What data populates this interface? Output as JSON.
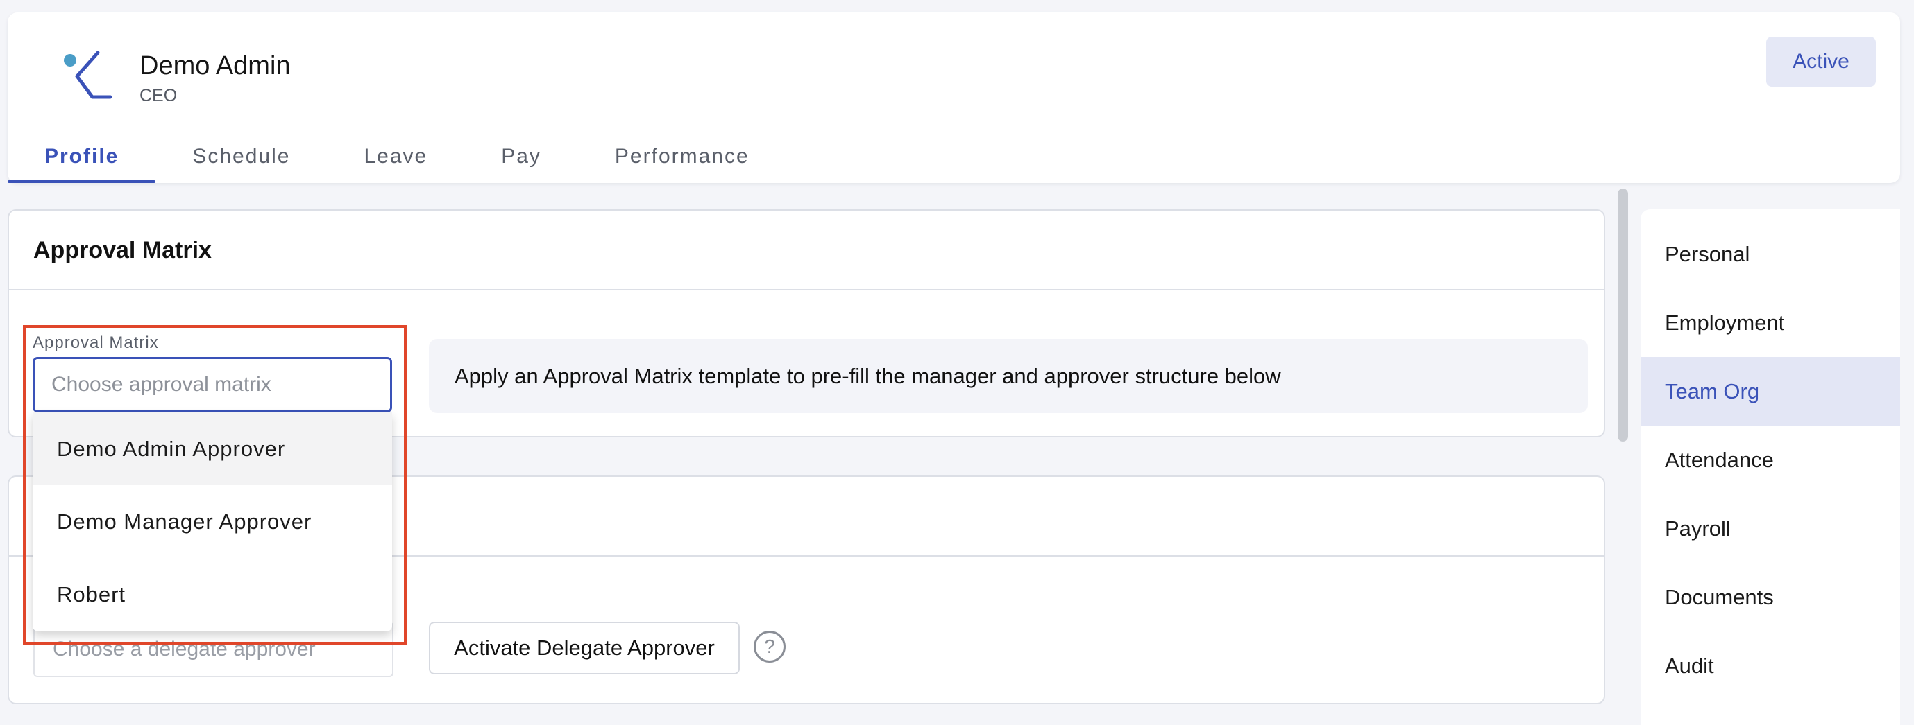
{
  "profile": {
    "name": "Demo Admin",
    "role": "CEO",
    "status": "Active"
  },
  "tabs": [
    {
      "label": "Profile",
      "active": true
    },
    {
      "label": "Schedule",
      "active": false
    },
    {
      "label": "Leave",
      "active": false
    },
    {
      "label": "Pay",
      "active": false
    },
    {
      "label": "Performance",
      "active": false
    }
  ],
  "approval_matrix": {
    "title": "Approval Matrix",
    "field_label": "Approval Matrix",
    "placeholder": "Choose approval matrix",
    "info_text": "Apply an Approval Matrix template to pre-fill the manager and approver structure below",
    "options": [
      "Demo Admin Approver",
      "Demo Manager Approver",
      "Robert"
    ]
  },
  "delegate": {
    "placeholder": "Choose a delegate approver",
    "button_label": "Activate Delegate Approver",
    "help_glyph": "?"
  },
  "sidenav": {
    "items": [
      "Personal",
      "Employment",
      "Team Org",
      "Attendance",
      "Payroll",
      "Documents",
      "Audit"
    ],
    "active": "Team Org"
  },
  "colors": {
    "accent": "#3a52b8",
    "highlight": "#e0462a",
    "logo_dot": "#4a9dc7"
  }
}
